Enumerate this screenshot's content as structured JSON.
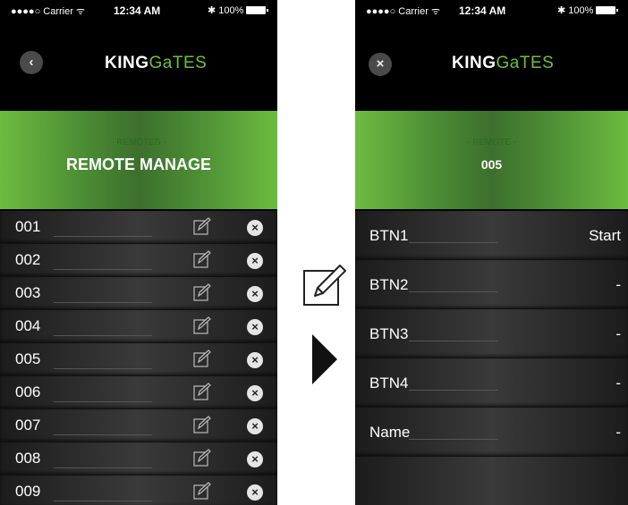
{
  "left_screen": {
    "status": {
      "signal": "●●●●○ Carrier ᯤ",
      "time": "12:34 AM",
      "battery": "✱ 100%"
    },
    "nav": {
      "back_icon": "‹",
      "logo_bold": "KING",
      "logo_light": "GaTES"
    },
    "banner": {
      "subtitle": "- REMOTES -",
      "title": "REMOTE MANAGE"
    },
    "rows": [
      {
        "code": "001"
      },
      {
        "code": "002"
      },
      {
        "code": "003"
      },
      {
        "code": "004"
      },
      {
        "code": "005"
      },
      {
        "code": "006"
      },
      {
        "code": "007"
      },
      {
        "code": "008"
      },
      {
        "code": "009"
      }
    ],
    "delete_glyph": "×"
  },
  "right_screen": {
    "status": {
      "signal": "●●●●○ Carrier ᯤ",
      "time": "12:34 AM",
      "battery": "✱ 100%"
    },
    "nav": {
      "close_icon": "×",
      "logo_bold": "KING",
      "logo_light": "GaTES"
    },
    "banner": {
      "subtitle": "- REMOTE -",
      "title": "005"
    },
    "buttons": [
      {
        "label": "BTN1",
        "value": "Start"
      },
      {
        "label": "BTN2",
        "value": "-"
      },
      {
        "label": "BTN3",
        "value": "-"
      },
      {
        "label": "BTN4",
        "value": "-"
      },
      {
        "label": "Name",
        "value": "-"
      }
    ]
  },
  "icons": {
    "edit": "edit-icon",
    "delete": "delete-icon",
    "arrow": "play-arrow-icon",
    "back": "back-icon",
    "close": "close-icon"
  },
  "colors": {
    "accent_green": "#6dc13b",
    "background": "#000000",
    "button_gray": "#4a4a4a"
  }
}
